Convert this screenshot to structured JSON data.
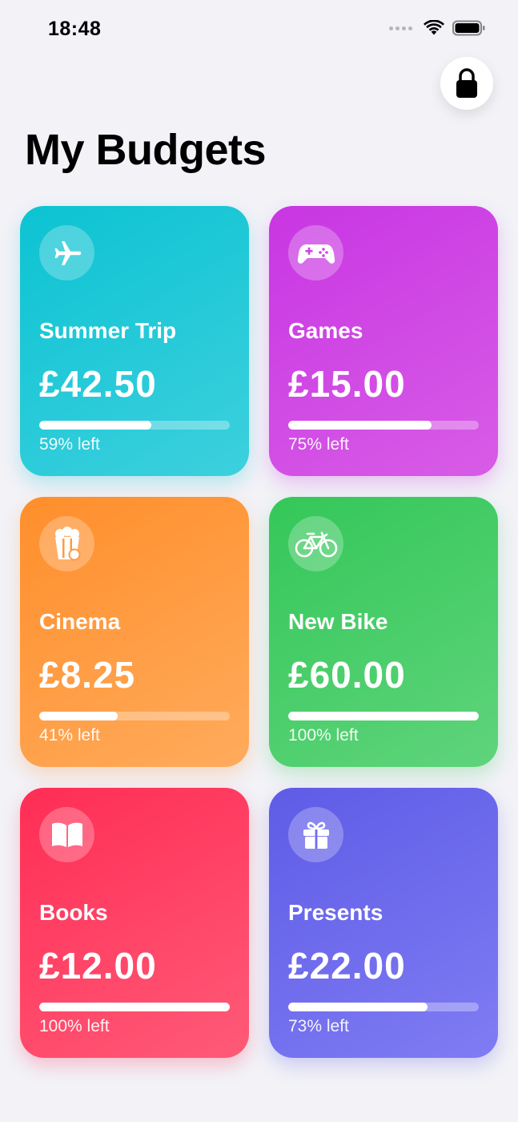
{
  "status_bar": {
    "time": "18:48",
    "icons": [
      "cellular-dots-icon",
      "wifi-icon",
      "battery-icon"
    ]
  },
  "header": {
    "title": "My Budgets",
    "lock_icon": "lock-icon"
  },
  "budgets": [
    {
      "name": "Summer Trip",
      "amount": "£42.50",
      "left_label": "59% left",
      "fraction_left": 0.59,
      "icon": "airplane-icon",
      "color_from": "#0cc3d2",
      "color_to": "#3dd0de"
    },
    {
      "name": "Games",
      "amount": "£15.00",
      "left_label": "75% left",
      "fraction_left": 0.75,
      "icon": "gamecontroller-icon",
      "color_from": "#c836e3",
      "color_to": "#d85ce6"
    },
    {
      "name": "Cinema",
      "amount": "£8.25",
      "left_label": "41% left",
      "fraction_left": 0.41,
      "icon": "popcorn-icon",
      "color_from": "#ff8e2b",
      "color_to": "#ffab5c"
    },
    {
      "name": "New Bike",
      "amount": "£60.00",
      "left_label": "100% left",
      "fraction_left": 1.0,
      "icon": "bicycle-icon",
      "color_from": "#34c759",
      "color_to": "#5fd47b"
    },
    {
      "name": "Books",
      "amount": "£12.00",
      "left_label": "100% left",
      "fraction_left": 1.0,
      "icon": "book-icon",
      "color_from": "#ff2d55",
      "color_to": "#ff5a78"
    },
    {
      "name": "Presents",
      "amount": "£22.00",
      "left_label": "73% left",
      "fraction_left": 0.73,
      "icon": "gift-icon",
      "color_from": "#5e5ce6",
      "color_to": "#807cf4"
    }
  ]
}
